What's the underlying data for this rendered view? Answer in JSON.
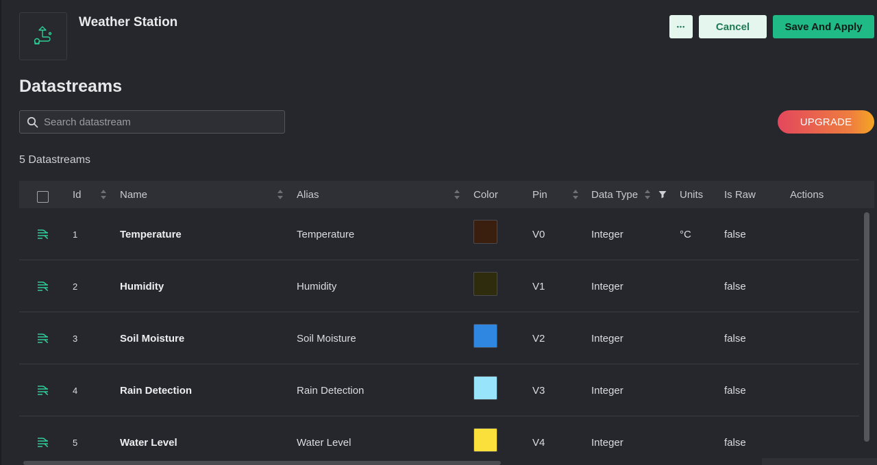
{
  "header": {
    "template_name": "Weather Station",
    "more_label": "•••",
    "cancel_label": "Cancel",
    "save_label": "Save And Apply"
  },
  "section": {
    "title": "Datastreams",
    "search_placeholder": "Search datastream",
    "upgrade_label": "UPGRADE",
    "count_label": "5 Datastreams"
  },
  "table": {
    "columns": {
      "id": "Id",
      "name": "Name",
      "alias": "Alias",
      "color": "Color",
      "pin": "Pin",
      "data_type": "Data Type",
      "units": "Units",
      "is_raw": "Is Raw",
      "actions": "Actions"
    },
    "rows": [
      {
        "id": "1",
        "name": "Temperature",
        "alias": "Temperature",
        "color": "#3a1f0e",
        "pin": "V0",
        "data_type": "Integer",
        "units": "°C",
        "is_raw": "false"
      },
      {
        "id": "2",
        "name": "Humidity",
        "alias": "Humidity",
        "color": "#2f2b0d",
        "pin": "V1",
        "data_type": "Integer",
        "units": "",
        "is_raw": "false"
      },
      {
        "id": "3",
        "name": "Soil Moisture",
        "alias": "Soil Moisture",
        "color": "#2f87e2",
        "pin": "V2",
        "data_type": "Integer",
        "units": "",
        "is_raw": "false"
      },
      {
        "id": "4",
        "name": "Rain Detection",
        "alias": "Rain Detection",
        "color": "#97e4fb",
        "pin": "V3",
        "data_type": "Integer",
        "units": "",
        "is_raw": "false"
      },
      {
        "id": "5",
        "name": "Water Level",
        "alias": "Water Level",
        "color": "#fbe03b",
        "pin": "V4",
        "data_type": "Integer",
        "units": "",
        "is_raw": "false"
      }
    ]
  },
  "colors": {
    "accent": "#1fba86",
    "background": "#26272c"
  }
}
